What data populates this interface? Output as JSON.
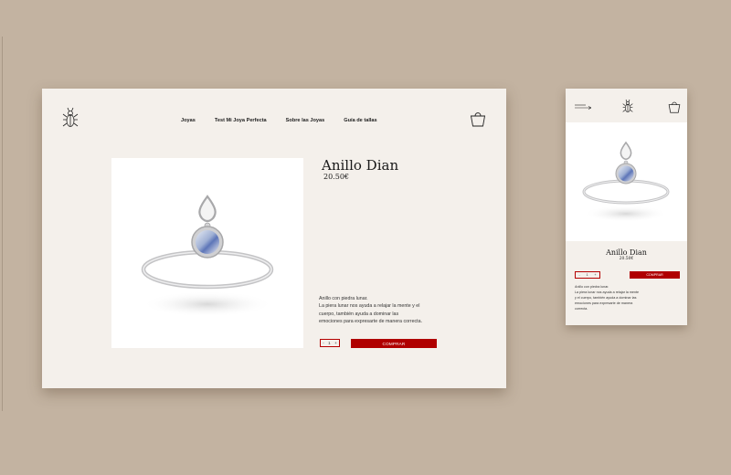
{
  "brand": {
    "logo_icon": "scarab-logo-icon"
  },
  "colors": {
    "background": "#c3b3a1",
    "panel": "#f4f0eb",
    "accent_red": "#b00000",
    "text": "#1a1a1a"
  },
  "desktop": {
    "nav": [
      "Joyas",
      "Test Mi Joya Perfecta",
      "Sobre las Joyas",
      "Guía de tallas"
    ],
    "product": {
      "title": "Anillo Dian",
      "price": "20.50€",
      "description_lines": [
        "Anillo con piedra lunar.",
        "La piera lunar nos ayuda a relajar la mente y el",
        "cuerpo, también ayuda a dominar las",
        "emociones para expresarte de manera correcta."
      ]
    },
    "quantity": {
      "minus": "-",
      "value": "1",
      "plus": "+"
    },
    "buy_label": "COMPRAR"
  },
  "mobile": {
    "product": {
      "title": "Anillo Dian",
      "price": "20.50€",
      "description_lines": [
        "Anillo con piedra lunar.",
        "La piera lunar nos ayuda a relajar la mente",
        "y el cuerpo, también ayuda a dominar las",
        "emociones para expresarte de manera",
        "correcta."
      ]
    },
    "quantity": {
      "minus": "-",
      "value": "1",
      "plus": "+"
    },
    "buy_label": "COMPRAR"
  }
}
